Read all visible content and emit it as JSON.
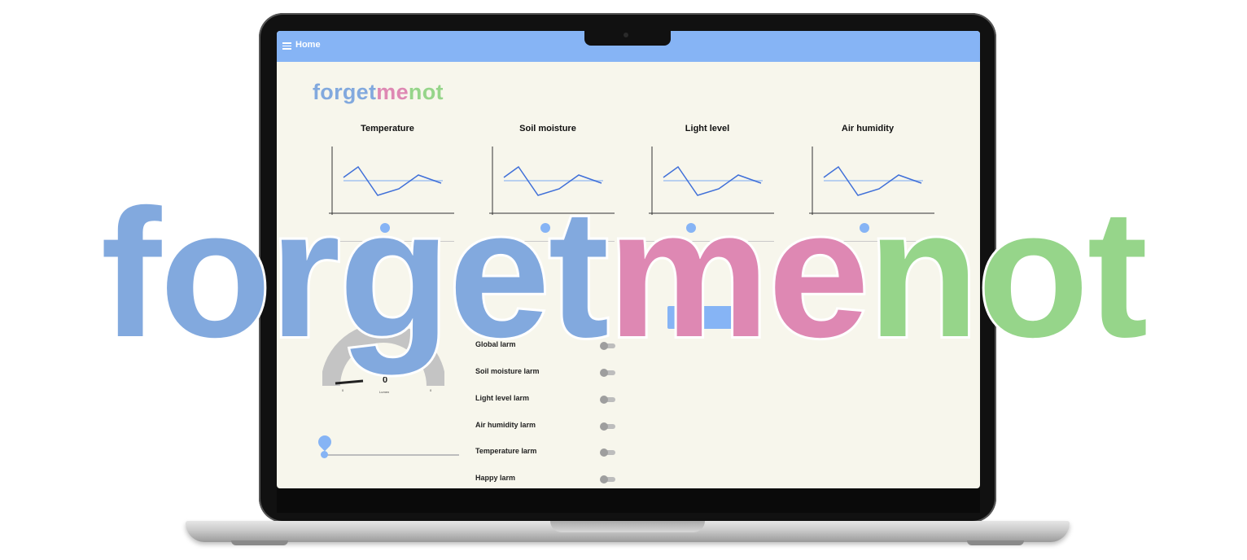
{
  "app": {
    "title": "Home"
  },
  "logo": {
    "part1": "forgetme",
    "p1": "forget",
    "p2": "me",
    "p3": "not",
    "colors": {
      "blue": "#82a9de",
      "pink": "#de88b3",
      "green": "#96d58a"
    }
  },
  "charts": [
    {
      "title": "Temperature"
    },
    {
      "title": "Soil moisture"
    },
    {
      "title": "Light level"
    },
    {
      "title": "Air humidity"
    }
  ],
  "gauge": {
    "value": "0",
    "unit": "Lumen",
    "min": "0",
    "max": "0"
  },
  "switches": [
    {
      "label": "Global larm"
    },
    {
      "label": "Soil moisture larm"
    },
    {
      "label": "Light level larm"
    },
    {
      "label": "Air humidity larm"
    },
    {
      "label": "Temperature larm"
    },
    {
      "label": "Happy larm"
    }
  ],
  "partial_label": "larm",
  "accent_color": "#86b4f5"
}
